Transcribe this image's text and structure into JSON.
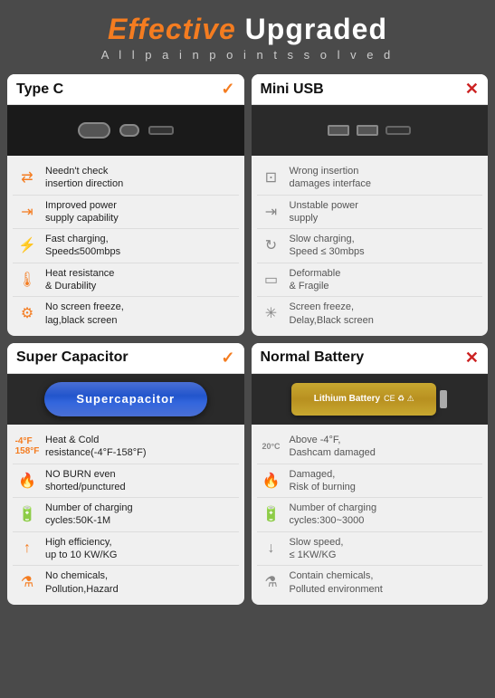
{
  "header": {
    "title_part1": "Effective",
    "title_part2": " Upgraded",
    "subtitle": "A l l   p a i n   p o i n t s   s o l v e d"
  },
  "cards": {
    "type_c": {
      "title": "Type C",
      "badge": "✓",
      "features": [
        {
          "icon": "⬛",
          "text": "Needn't check\ninsertion direction"
        },
        {
          "icon": "⚡",
          "text": "Improved power\nsupply capability"
        },
        {
          "icon": "⚡⚡",
          "text": "Fast charging,\nSpeed≤500mbps"
        },
        {
          "icon": "🌡",
          "text": "Heat resistance\n& Durability"
        },
        {
          "icon": "⚙",
          "text": "No screen freeze,\nlag,black screen"
        }
      ]
    },
    "mini_usb": {
      "title": "Mini USB",
      "badge": "✕",
      "features": [
        {
          "icon": "⚠",
          "text": "Wrong insertion\ndamages interface"
        },
        {
          "icon": "⚡",
          "text": "Unstable power\nsupply"
        },
        {
          "icon": "🔄",
          "text": "Slow charging,\nSpeed ≤ 30mbps"
        },
        {
          "icon": "📦",
          "text": "Deformable\n& Fragile"
        },
        {
          "icon": "💫",
          "text": "Screen freeze,\nDelay,Black screen"
        }
      ]
    },
    "super_cap": {
      "title": "Super Capacitor",
      "badge": "✓",
      "label": "Supercapacitor",
      "features": [
        {
          "icon": "🌡",
          "text": "Heat & Cold\nresistance(-4°F-158°F)",
          "prefix": "-4°F-158°F"
        },
        {
          "icon": "🔥",
          "text": "NO BURN even\nshorted/punctured"
        },
        {
          "icon": "🔋",
          "text": "Number of charging\ncycles:50K-1M"
        },
        {
          "icon": "⬆",
          "text": "High efficiency,\nup to 10 KW/KG"
        },
        {
          "icon": "⚗",
          "text": "No chemicals,\nPollution,Hazard"
        }
      ]
    },
    "normal_battery": {
      "title": "Normal Battery",
      "badge": "✕",
      "label": "Lithium Battery",
      "features": [
        {
          "icon": "🌡",
          "text": "Above -4°F,\nDashcam damaged",
          "prefix": "20°C"
        },
        {
          "icon": "🔥",
          "text": "Damaged,\nRisk of burning"
        },
        {
          "icon": "🔋",
          "text": "Number of charging\ncycles:300~3000"
        },
        {
          "icon": "⬇",
          "text": "Slow speed,\n≤ 1KW/KG"
        },
        {
          "icon": "⚗",
          "text": "Contain chemicals,\nPolluted environment"
        }
      ]
    }
  }
}
